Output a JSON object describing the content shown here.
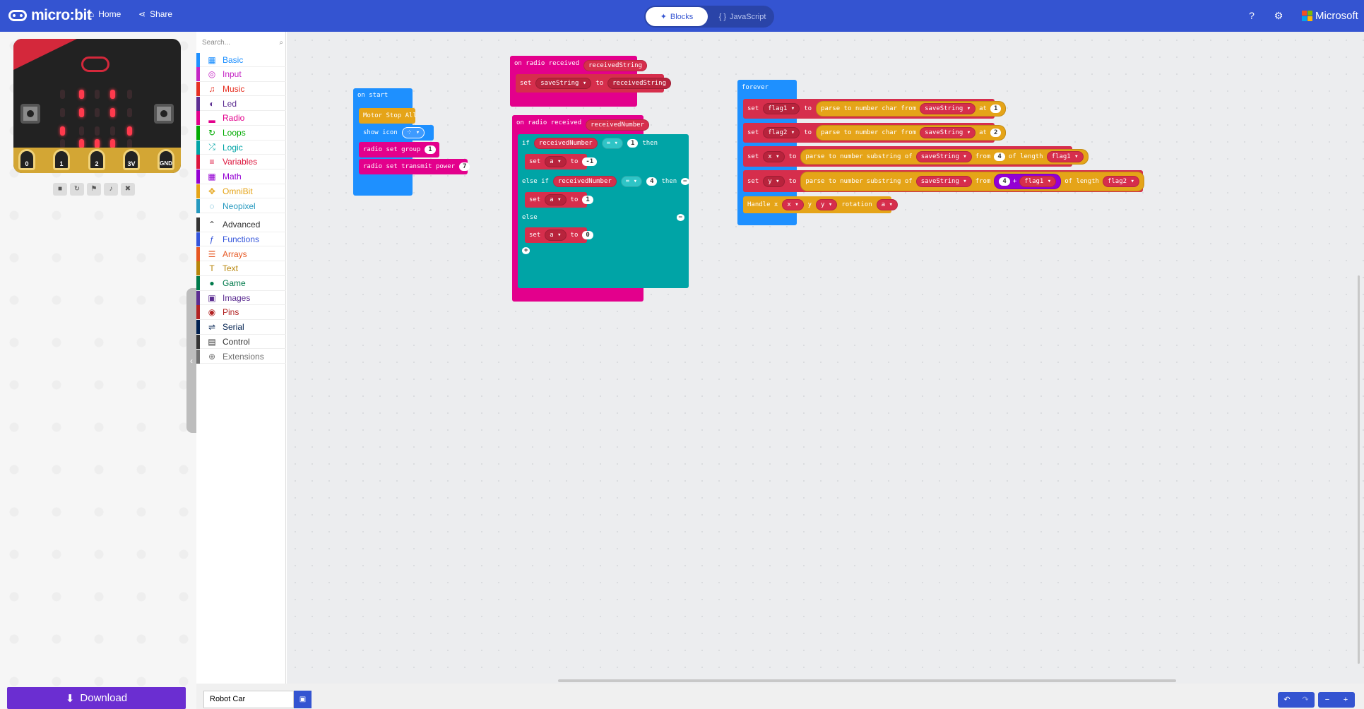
{
  "header": {
    "brand": "micro:bit",
    "home_label": "Home",
    "share_label": "Share",
    "blocks_label": "Blocks",
    "javascript_label": "JavaScript",
    "microsoft_label": "Microsoft"
  },
  "simulator": {
    "pin_labels": [
      "0",
      "1",
      "2",
      "3V",
      "GND"
    ]
  },
  "toolbox": {
    "search_placeholder": "Search...",
    "categories": [
      {
        "label": "Basic",
        "color": "#1e90ff",
        "icon": "grid-icon"
      },
      {
        "label": "Input",
        "color": "#c425c4",
        "icon": "target-icon"
      },
      {
        "label": "Music",
        "color": "#e63022",
        "icon": "headphones-icon"
      },
      {
        "label": "Led",
        "color": "#5c2d91",
        "icon": "toggle-icon"
      },
      {
        "label": "Radio",
        "color": "#e3008c",
        "icon": "signal-icon"
      },
      {
        "label": "Loops",
        "color": "#00aa00",
        "icon": "loop-icon"
      },
      {
        "label": "Logic",
        "color": "#00a4a6",
        "icon": "shuffle-icon"
      },
      {
        "label": "Variables",
        "color": "#dc143c",
        "icon": "list-icon"
      },
      {
        "label": "Math",
        "color": "#9400d3",
        "icon": "calculator-icon"
      },
      {
        "label": "OmniBit",
        "color": "#e5a418",
        "icon": "move-icon"
      },
      {
        "label": "Neopixel",
        "color": "#2699bf",
        "icon": "ring-icon"
      },
      {
        "label": "Advanced",
        "color": "#333333",
        "icon": "chevron-up-icon"
      },
      {
        "label": "Functions",
        "color": "#3455db",
        "icon": "function-icon"
      },
      {
        "label": "Arrays",
        "color": "#e65722",
        "icon": "array-icon"
      },
      {
        "label": "Text",
        "color": "#b8860b",
        "icon": "text-icon"
      },
      {
        "label": "Game",
        "color": "#007a4b",
        "icon": "gamepad-icon"
      },
      {
        "label": "Images",
        "color": "#5c2d91",
        "icon": "image-icon"
      },
      {
        "label": "Pins",
        "color": "#b22222",
        "icon": "pin-icon"
      },
      {
        "label": "Serial",
        "color": "#002050",
        "icon": "usb-icon"
      },
      {
        "label": "Control",
        "color": "#333333",
        "icon": "control-icon"
      },
      {
        "label": "Extensions",
        "color": "#717171",
        "icon": "plus-circle-icon"
      }
    ]
  },
  "blocks": {
    "on_start": {
      "label": "on start",
      "motor_stop": "Motor Stop All",
      "show_icon": "show icon",
      "radio_group": "radio set group",
      "radio_group_val": "1",
      "radio_power": "radio set transmit power",
      "radio_power_val": "7"
    },
    "radio_string": {
      "label": "on radio received",
      "param": "receivedString",
      "set": "set",
      "var": "saveString",
      "to": "to",
      "value": "receivedString"
    },
    "radio_number": {
      "label": "on radio received",
      "param": "receivedNumber",
      "if": "if",
      "cond_var": "receivedNumber",
      "op": "=",
      "cond_val1": "1",
      "then": "then",
      "set": "set",
      "a_var": "a",
      "to": "to",
      "val_neg1": "-1",
      "else_if": "else if",
      "cond_val4": "4",
      "val_1": "1",
      "else": "else",
      "val_0": "0"
    },
    "forever": {
      "label": "forever",
      "set": "set",
      "to": "to",
      "flag1": "flag1",
      "flag2": "flag2",
      "x": "x",
      "y": "y",
      "parse": "parse to number",
      "char_from": "char from",
      "substring_of": "substring of",
      "save_string": "saveString",
      "at": "at",
      "at1": "1",
      "at2": "2",
      "from": "from",
      "from4": "4",
      "of_length": "of length",
      "plus": "+",
      "handle": "Handle x",
      "y_label": "y",
      "rotation": "rotation",
      "a": "a"
    }
  },
  "footer": {
    "download_label": "Download",
    "project_name": "Robot Car"
  }
}
